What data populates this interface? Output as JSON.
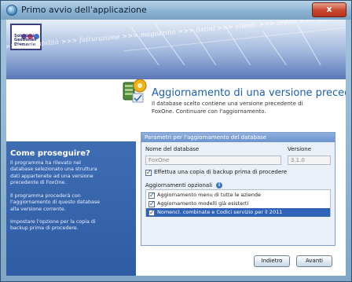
{
  "window": {
    "title": "Primo avvio dell'applicazione",
    "close_label": "x"
  },
  "logo": {
    "line1": "Soluzioni",
    "line2": "Gestionali",
    "line3": "Diamante",
    "dot_colors": [
      "#7a4fb0",
      "#d23a7a",
      "#3c6fd0"
    ]
  },
  "banner": {
    "ticker": ">>> contabilità >>> fatturazione >>> magazzino >>> listini >>> clienti >>> ordini >>> statist"
  },
  "header": {
    "title": "Aggiornamento di una versione precedente",
    "subtitle": "Il database scelto contiene una versione precedente di FoxOne. Continuare con l'aggiornamento."
  },
  "left_panel": {
    "title": "Come proseguire?",
    "paragraphs": [
      "Il programma ha rilevato nel database selezionato una struttura dati appartenete ad una versione precedente di FoxOne.",
      "Il programma procederà con l'aggiornamento di questo database alla versione corrente.",
      "Impostare l'opzione per la copia di backup prima di procedere."
    ]
  },
  "params": {
    "header": "Parametri per l'aggiornamento del database",
    "db_name_label": "Nome del database",
    "db_name_value": "FoxOne",
    "version_label": "Versione",
    "version_value": "3.1.0",
    "backup_label": "Effettua una copia di backup prima di procedere",
    "backup_checked": true,
    "optional_label": "Aggiornamenti opzionali",
    "options": [
      {
        "label": "Aggiornamento menu di tutte le aziende",
        "checked": true,
        "selected": false
      },
      {
        "label": "Aggiornamento modelli già esisterti",
        "checked": true,
        "selected": false
      },
      {
        "label": "Nomencl. combinate e Codici servizio per il 2011",
        "checked": true,
        "selected": true
      }
    ]
  },
  "buttons": {
    "back": "Indietro",
    "next": "Avanti"
  },
  "colors": {
    "accent_blue": "#1c5fae",
    "panel_blue": "#3f6db3",
    "selection": "#2f63b8"
  }
}
